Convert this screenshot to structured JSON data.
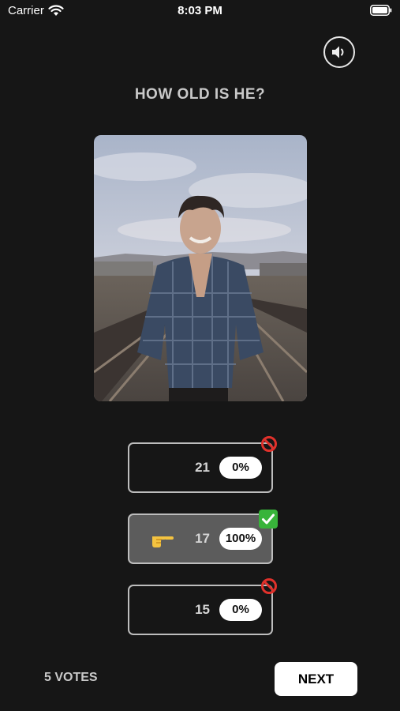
{
  "status_bar": {
    "carrier": "Carrier",
    "time": "8:03 PM"
  },
  "quiz": {
    "question": "HOW OLD IS HE?",
    "answers": [
      {
        "age": "21",
        "percent": "0%",
        "status": "wrong"
      },
      {
        "age": "17",
        "percent": "100%",
        "status": "correct",
        "selected": true
      },
      {
        "age": "15",
        "percent": "0%",
        "status": "wrong"
      }
    ]
  },
  "footer": {
    "votes": "5 VOTES",
    "next_label": "NEXT"
  },
  "icons": {
    "sound": "speaker-icon",
    "wrong": "prohibited-icon",
    "correct": "check-mark-icon",
    "pointer": "pointing-hand-icon"
  },
  "colors": {
    "background": "#161616",
    "correct_fill": "#5c5c5c",
    "wrong_badge": "#e0312b",
    "correct_badge": "#38b43a"
  }
}
